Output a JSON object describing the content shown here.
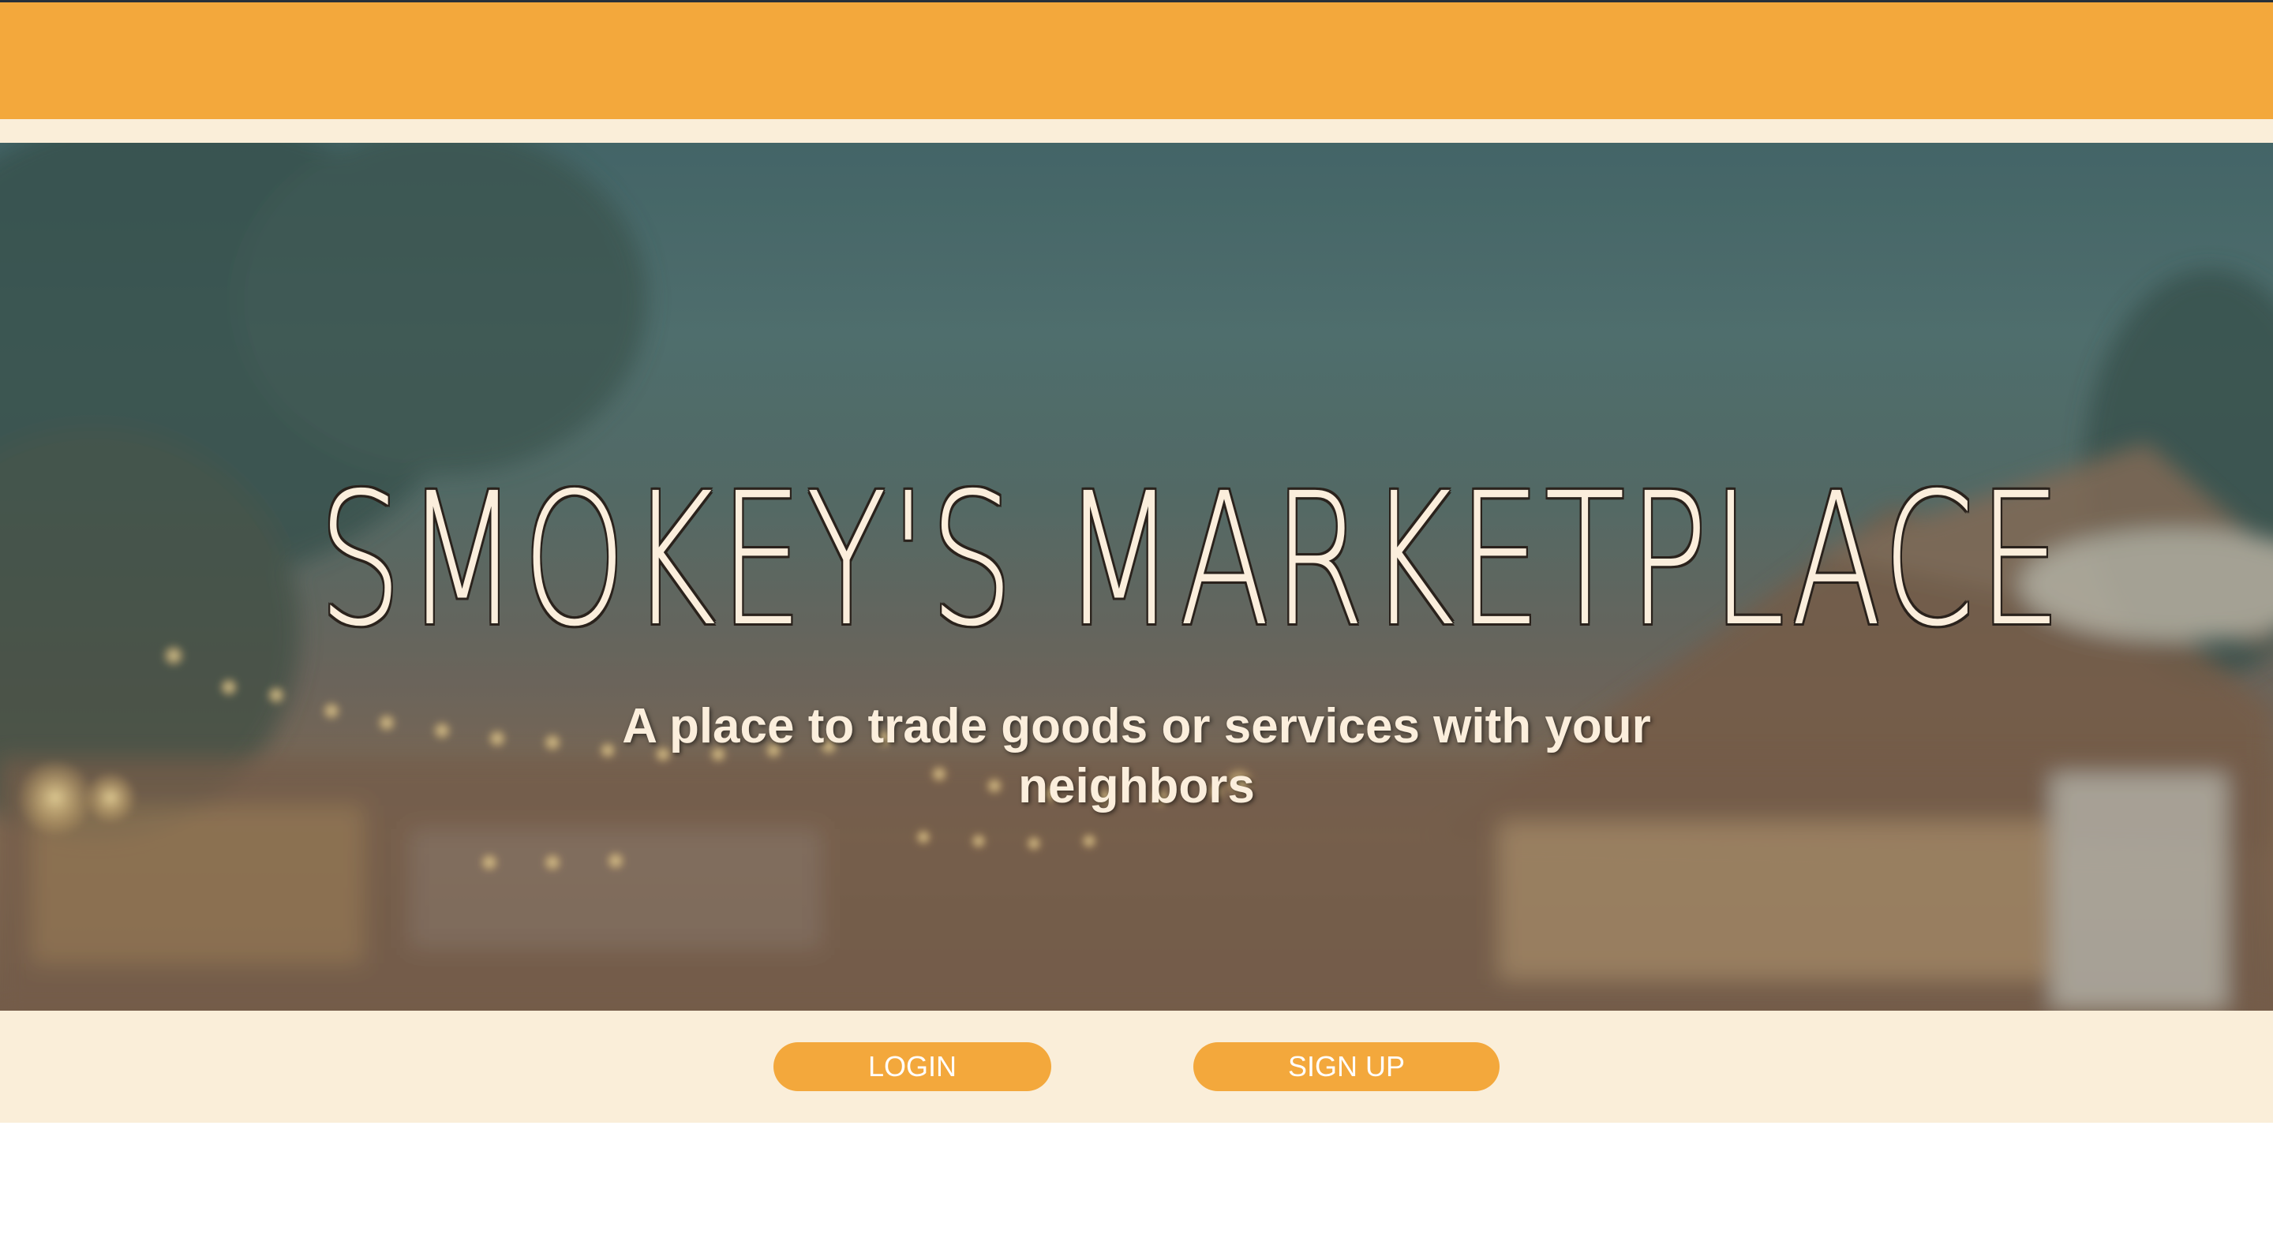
{
  "hero": {
    "title": "SMOKEY'S MARKETPLACE",
    "subtitle": "A place to trade goods or services with your neighbors"
  },
  "actions": {
    "login_label": "LOGIN",
    "signup_label": "SIGN UP"
  },
  "colors": {
    "accent": "#f3a83c",
    "cream": "#faeed9",
    "title_text": "#fbeedc"
  }
}
